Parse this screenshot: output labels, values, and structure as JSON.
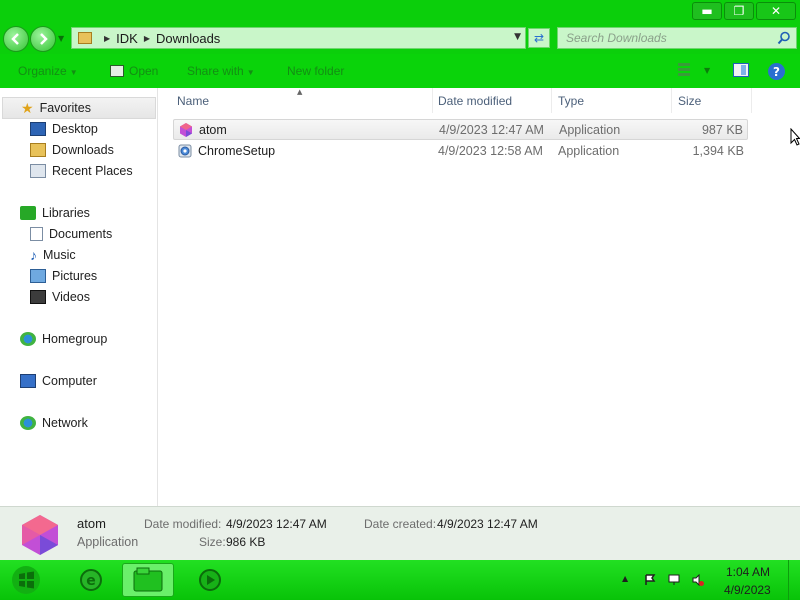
{
  "window": {
    "controls": {
      "minimize": "▬",
      "restore": "❐",
      "close": "✕"
    }
  },
  "address": {
    "breadcrumb": [
      "IDK",
      "Downloads"
    ],
    "search_placeholder": "Search Downloads"
  },
  "toolbar": {
    "organize": "Organize",
    "open": "Open",
    "share_with": "Share with",
    "new_folder": "New folder"
  },
  "nav": {
    "favorites": "Favorites",
    "favorite_items": [
      "Desktop",
      "Downloads",
      "Recent Places"
    ],
    "libraries": "Libraries",
    "library_items": [
      "Documents",
      "Music",
      "Pictures",
      "Videos"
    ],
    "homegroup": "Homegroup",
    "computer": "Computer",
    "network": "Network"
  },
  "columns": {
    "name": "Name",
    "date_modified": "Date modified",
    "type": "Type",
    "size": "Size"
  },
  "files": [
    {
      "name": "atom",
      "date_modified": "4/9/2023 12:47 AM",
      "type": "Application",
      "size": "987 KB",
      "icon": "atom-icon",
      "selected": true
    },
    {
      "name": "ChromeSetup",
      "date_modified": "4/9/2023 12:58 AM",
      "type": "Application",
      "size": "1,394 KB",
      "icon": "chrome-setup-icon",
      "selected": false
    }
  ],
  "details": {
    "name": "atom",
    "type": "Application",
    "date_modified_label": "Date modified:",
    "date_modified": "4/9/2023 12:47 AM",
    "date_created_label": "Date created:",
    "date_created": "4/9/2023 12:47 AM",
    "size_label": "Size:",
    "size": "986 KB"
  },
  "taskbar": {
    "time": "1:04 AM",
    "date": "4/9/2023"
  },
  "colors": {
    "chrome": "#0bcf0b",
    "toolbar_text": "#138e13",
    "selection": "#eaeaea"
  }
}
